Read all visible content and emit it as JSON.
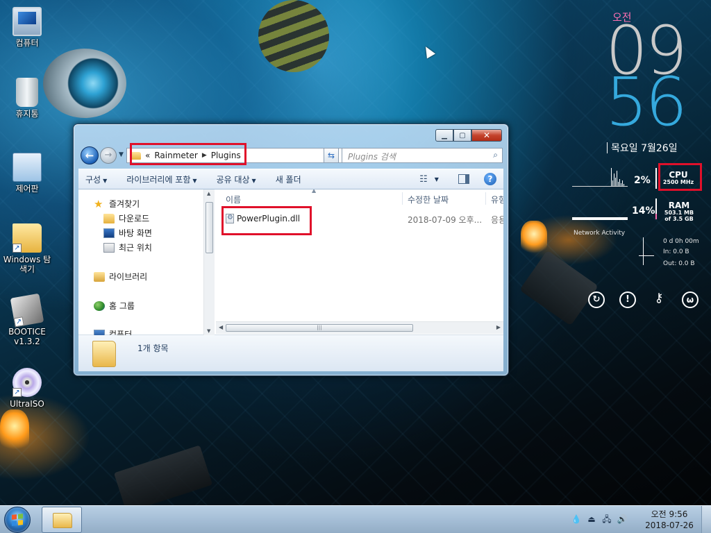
{
  "desktop": {
    "icons": [
      {
        "label": "컴퓨터",
        "icon": "computer-icon"
      },
      {
        "label": "휴지통",
        "icon": "recycle-bin-icon"
      },
      {
        "label": "제어판",
        "icon": "control-panel-icon"
      },
      {
        "label": "Windows 탐색기",
        "icon": "explorer-icon"
      },
      {
        "label": "BOOTICE v1.3.2",
        "icon": "bootice-icon"
      },
      {
        "label": "UltraISO",
        "icon": "ultraiso-icon"
      }
    ]
  },
  "explorer": {
    "address": {
      "chevron": "«",
      "segments": [
        "Rainmeter",
        "Plugins"
      ]
    },
    "search_placeholder": "Plugins 검색",
    "toolbar": {
      "organize": "구성",
      "include_library": "라이브러리에 포함",
      "share": "공유 대상",
      "new_folder": "새 폴더"
    },
    "nav": {
      "favorites": "즐겨찾기",
      "downloads": "다운로드",
      "desktop": "바탕 화면",
      "recent": "최근 위치",
      "libraries": "라이브러리",
      "homegroup": "홈 그룹",
      "computer": "컴퓨터"
    },
    "columns": {
      "name": "이름",
      "modified": "수정한 날짜",
      "type": "유형"
    },
    "files": [
      {
        "name": "PowerPlugin.dll",
        "modified": "2018-07-09 오후...",
        "type": "응용"
      }
    ],
    "status": "1개 항목"
  },
  "widgets": {
    "clock": {
      "ampm": "오전",
      "hour": "09",
      "minute": "56",
      "date": "목요일 7월26일"
    },
    "cpu": {
      "percent": "2%",
      "label": "CPU",
      "speed": "2500 MHz"
    },
    "ram": {
      "percent": "14%",
      "label": "RAM",
      "used": "503.1 MB",
      "total": "of 3.5 GB"
    },
    "network": {
      "title": "Network Activity",
      "uptime": "0 d 0h 00m",
      "in": "In: 0.0 B",
      "out": "Out: 0.0 B"
    }
  },
  "taskbar": {
    "time": "오전 9:56",
    "date": "2018-07-26"
  },
  "colors": {
    "highlight": "#e0102a",
    "clock_hour": "#c9c9c9",
    "clock_minute": "#35a9dd",
    "ampm": "#ff6fb2"
  }
}
